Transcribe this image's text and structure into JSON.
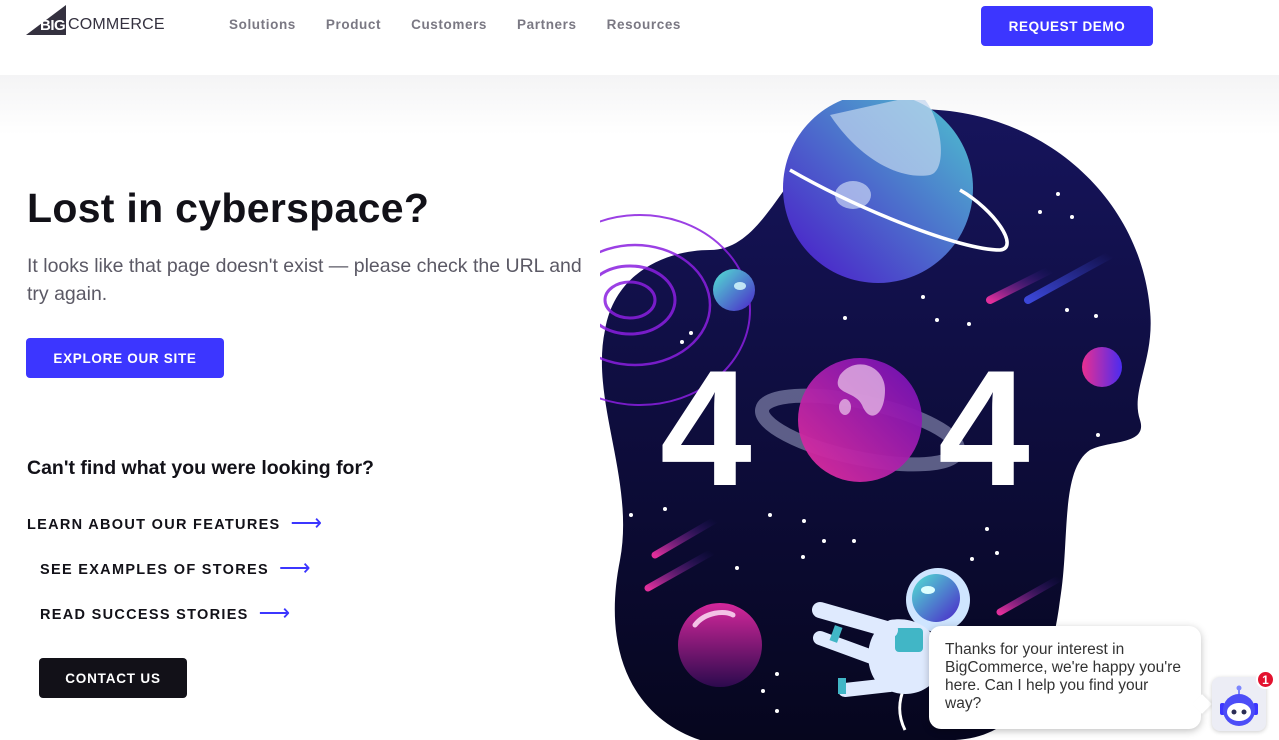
{
  "header": {
    "logo": {
      "big": "BIG",
      "commerce": "COMMERCE"
    },
    "nav": [
      "Solutions",
      "Product",
      "Customers",
      "Partners",
      "Resources"
    ],
    "cta": "REQUEST DEMO"
  },
  "hero": {
    "title": "Lost in cyberspace?",
    "subtitle": "It looks like that page doesn't exist — please check the URL and try again.",
    "explore_button": "EXPLORE OUR SITE"
  },
  "help": {
    "heading": "Can't find what you were looking for?",
    "links": [
      {
        "label": "LEARN ABOUT OUR FEATURES",
        "icon": "arrow-right-icon"
      },
      {
        "label": "SEE EXAMPLES OF STORES",
        "icon": "arrow-right-icon"
      },
      {
        "label": "READ SUCCESS STORIES",
        "icon": "arrow-right-icon"
      }
    ],
    "contact_button": "CONTACT US"
  },
  "illustration": {
    "text": "404",
    "digit_left": "4",
    "digit_right": "4",
    "description": "space scene with planets, shooting stars and floating astronaut"
  },
  "chat": {
    "message": "Thanks for your interest in BigCommerce, we're happy you're here. Can I help you find your way?",
    "unread_count": "1",
    "icon": "chatbot-icon"
  },
  "colors": {
    "brand": "#3c36ff",
    "dark": "#121118",
    "space": "#0d0c45",
    "badge": "#e3122f"
  },
  "arrow_glyph": "⟶"
}
